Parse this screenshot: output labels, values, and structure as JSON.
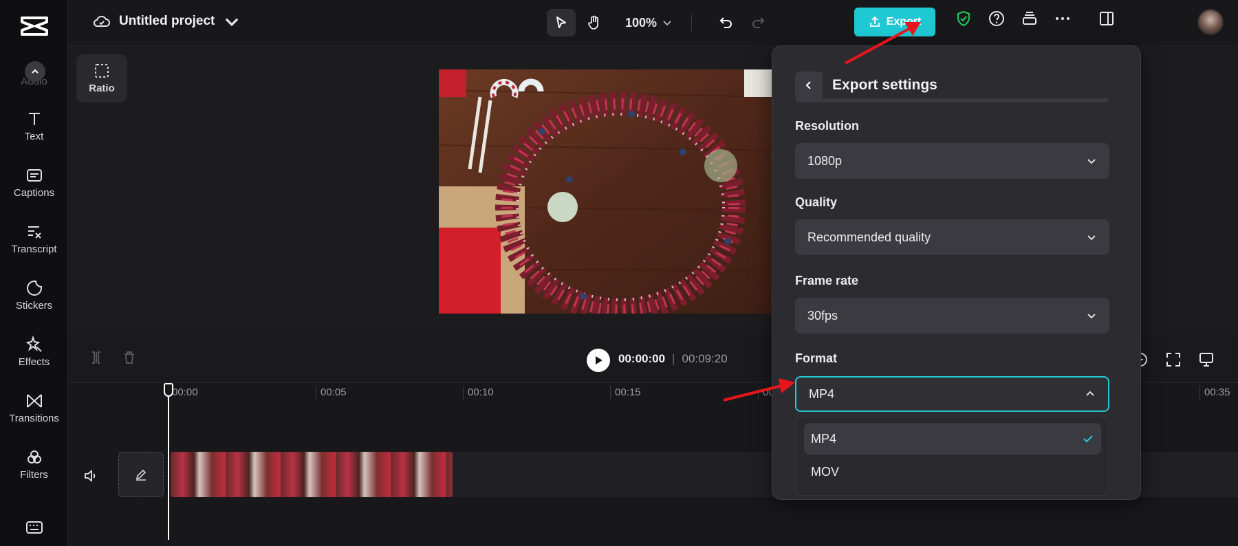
{
  "app": {
    "project_title": "Untitled project"
  },
  "toolbar": {
    "zoom": "100%",
    "export_label": "Export"
  },
  "sidebar": {
    "ghost_label": "Audio",
    "items": [
      {
        "label": "Text",
        "icon": "text-icon"
      },
      {
        "label": "Captions",
        "icon": "captions-icon"
      },
      {
        "label": "Transcript",
        "icon": "transcript-icon"
      },
      {
        "label": "Stickers",
        "icon": "stickers-icon"
      },
      {
        "label": "Effects",
        "icon": "effects-icon"
      },
      {
        "label": "Transitions",
        "icon": "transitions-icon"
      },
      {
        "label": "Filters",
        "icon": "filters-icon"
      }
    ]
  },
  "canvas": {
    "ratio_label": "Ratio"
  },
  "timeline": {
    "current_time": "00:00:00",
    "total_time": "00:09:20",
    "ruler": [
      "00:00",
      "00:05",
      "00:10",
      "00:15",
      "00",
      "00:35"
    ]
  },
  "export_panel": {
    "title": "Export settings",
    "resolution": {
      "label": "Resolution",
      "value": "1080p"
    },
    "quality": {
      "label": "Quality",
      "value": "Recommended quality"
    },
    "frame_rate": {
      "label": "Frame rate",
      "value": "30fps"
    },
    "format": {
      "label": "Format",
      "value": "MP4",
      "options": [
        "MP4",
        "MOV"
      ],
      "selected": "MP4"
    }
  },
  "colors": {
    "accent": "#1fc9d3",
    "annotation_arrow": "#e8141c",
    "shield": "#22c55e"
  }
}
